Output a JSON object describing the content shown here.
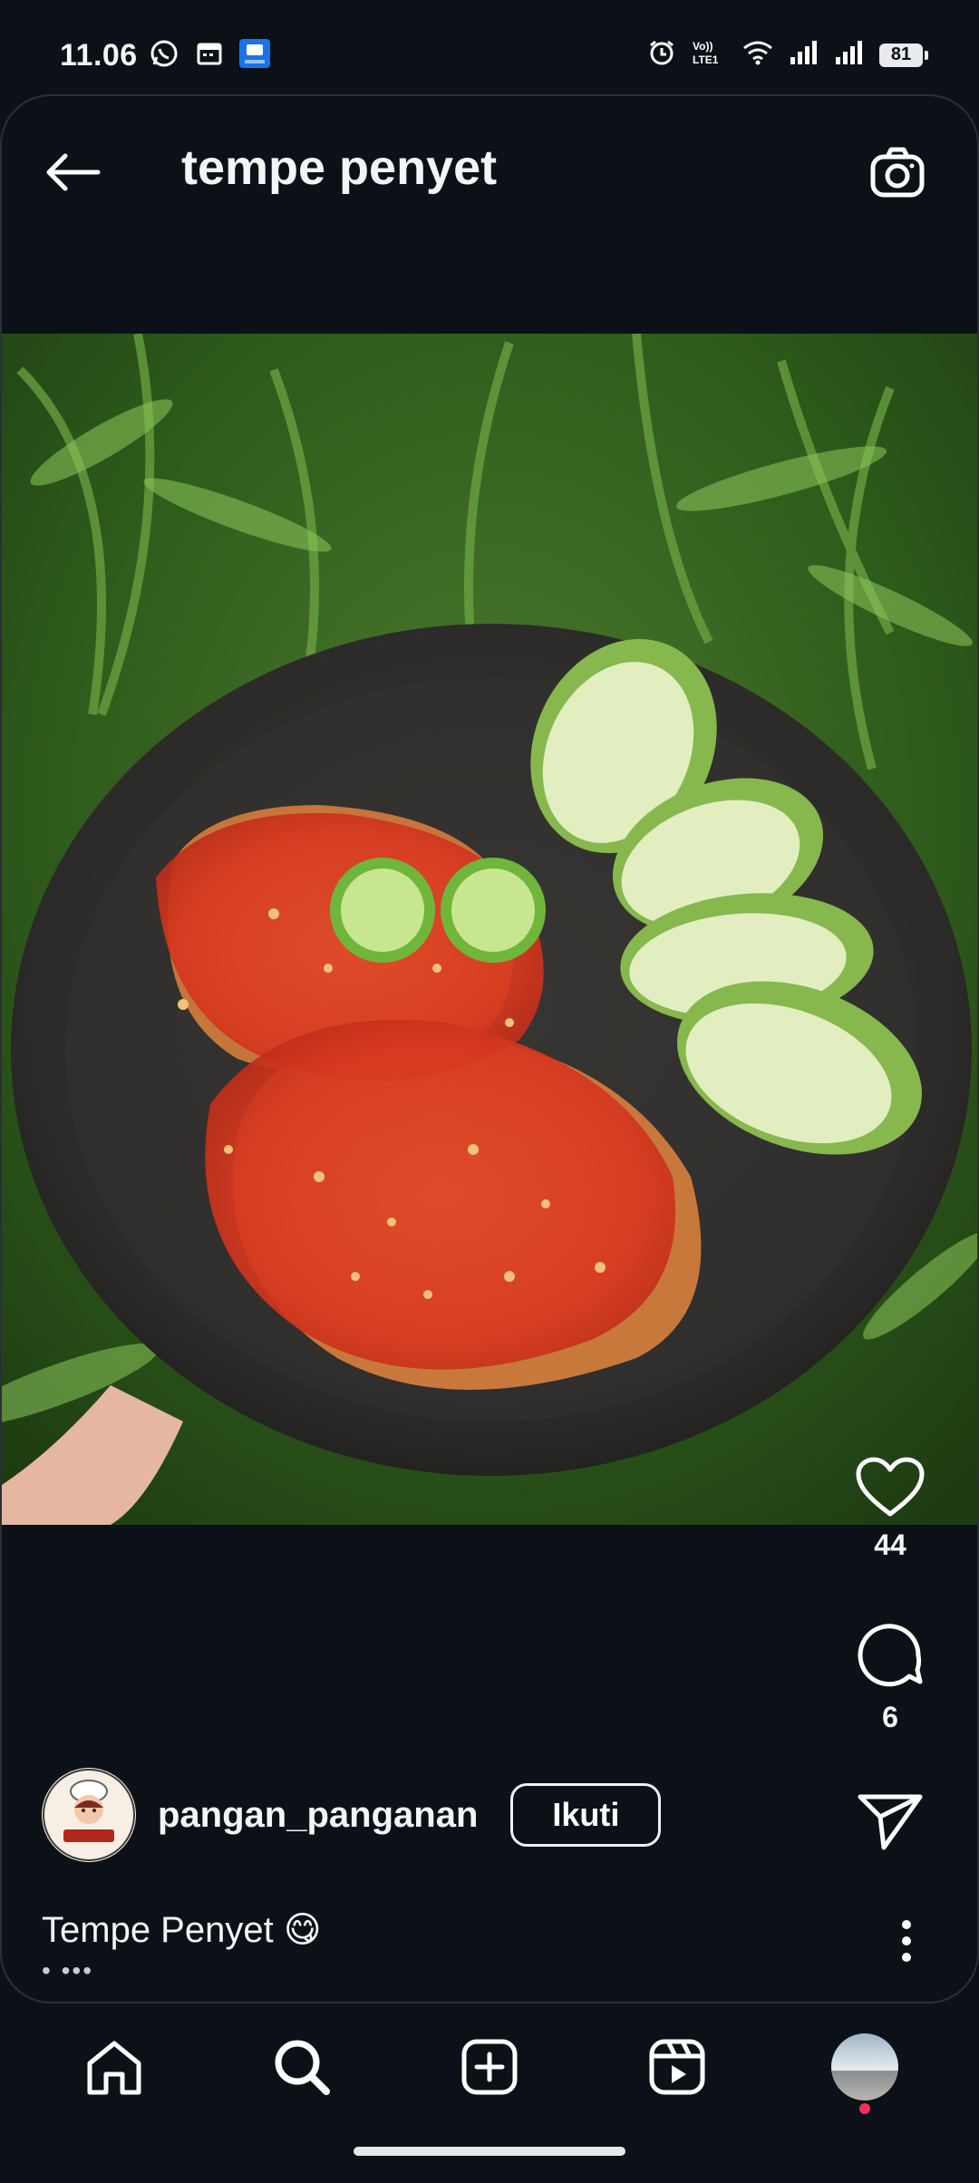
{
  "status_bar": {
    "time": "11.06",
    "battery": "81",
    "left_icons": [
      "whatsapp-icon",
      "calendar-icon",
      "app-store-icon"
    ],
    "right_icons": [
      "alarm-icon",
      "volte-icon",
      "wifi-icon",
      "signal-icon",
      "signal-icon"
    ]
  },
  "header": {
    "title": "tempe penyet",
    "back_icon": "arrow-left-icon",
    "camera_icon": "camera-icon"
  },
  "actions": {
    "likes": "44",
    "comments": "6"
  },
  "post": {
    "username": "pangan_panganan",
    "follow_label": "Ikuti",
    "caption": "Tempe Penyet 😋",
    "caption_more": "• •••"
  },
  "bottom_nav": [
    "home-icon",
    "search-icon",
    "create-icon",
    "reels-icon",
    "profile-avatar"
  ],
  "colors": {
    "background": "#0b1116",
    "text": "#f4f5f6",
    "notification": "#ff2d55"
  }
}
